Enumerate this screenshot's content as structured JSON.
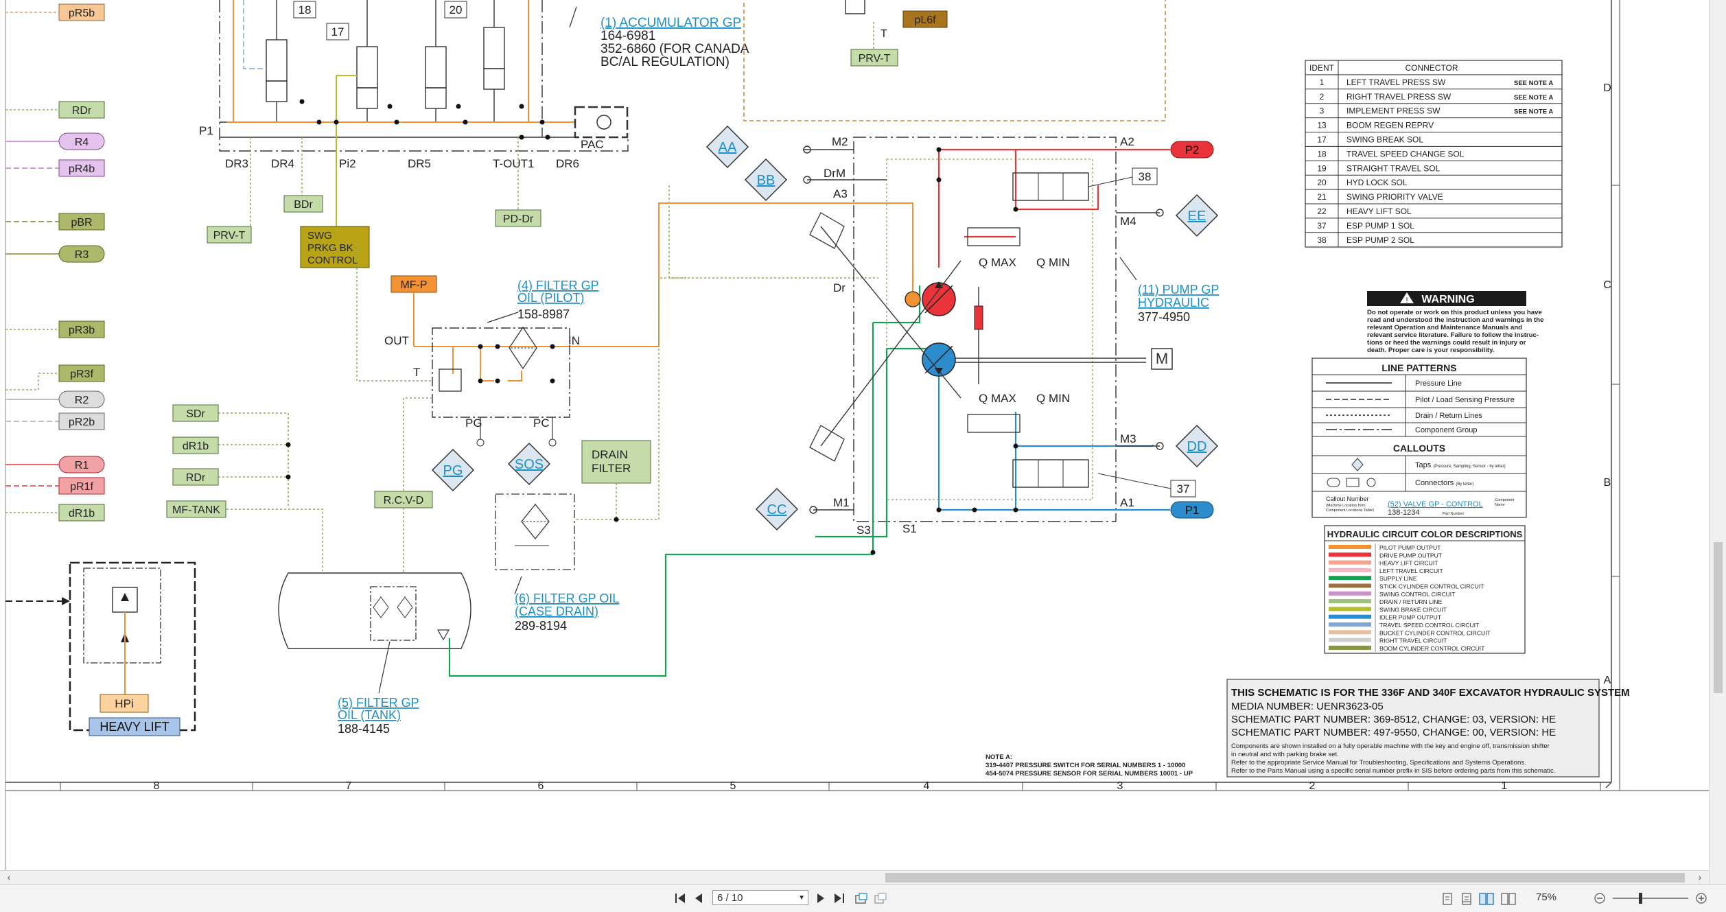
{
  "viewer": {
    "page_indicator": "6 / 10",
    "zoom": "75%",
    "colors": {
      "accent": "#1a8fc9",
      "toolbar_bg": "#f3f3f3"
    }
  },
  "top": {
    "left_tags": [
      "pR5b",
      "RDr",
      "R4",
      "pR4b",
      "pBR",
      "R3",
      "pR3b",
      "pR3f",
      "R2",
      "pR2b",
      "R1",
      "pR1f",
      "dR1b"
    ],
    "numbers": [
      "18",
      "17",
      "20"
    ],
    "p1": "P1",
    "pac": "PAC",
    "ports": [
      "DR3",
      "DR4",
      "Pi2",
      "DR5",
      "T-OUT1",
      "DR6"
    ],
    "accumulator": {
      "link": "(1) ACCUMULATOR GP",
      "pn1": "164-6981",
      "pn2": "352-6860 (FOR CANADA",
      "pn3": "BC/AL REGULATION)"
    },
    "pl6f": "pL6f",
    "t_label": "T",
    "prvt_top": "PRV-T",
    "bdr": "BDr",
    "prvt": "PRV-T",
    "pddr": "PD-Dr",
    "swg": [
      "SWG",
      "PRKG BK",
      "CONTROL"
    ],
    "mfp": "MF-P"
  },
  "filters": {
    "pilot": {
      "link1": "(4) FILTER GP",
      "link2": "OIL (PILOT)",
      "pn": "158-8987"
    },
    "out": "OUT",
    "in": "IN",
    "t": "T",
    "pg": "PG",
    "pc": "PC",
    "case": {
      "link1": "(6) FILTER GP OIL",
      "link2": "(CASE DRAIN)",
      "pn": "289-8194"
    },
    "tank": {
      "link1": "(5) FILTER GP",
      "link2": "OIL (TANK)",
      "pn": "188-4145"
    },
    "drain_filter": [
      "DRAIN",
      "FILTER"
    ],
    "taps": [
      "PG",
      "SOS"
    ],
    "rcvd": "R.C.V-D",
    "sdr": "SDr",
    "dr1b": "dR1b",
    "rdr": "RDr",
    "mftank": "MF-TANK"
  },
  "heavy": {
    "hpi": "HPi",
    "heavy_lift": "HEAVY LIFT"
  },
  "pump": {
    "taps": [
      "AA",
      "BB",
      "EE",
      "CC",
      "DD"
    ],
    "m2": "M2",
    "a2": "A2",
    "drm": "DrM",
    "a3": "A3",
    "m4": "M4",
    "dr": "Dr",
    "m3": "M3",
    "m1": "M1",
    "a1": "A1",
    "s3": "S3",
    "s1": "S1",
    "p2": "P2",
    "p1": "P1",
    "qmax": "Q MAX",
    "qmin": "Q MIN",
    "n38": "38",
    "n37": "37",
    "link1": "(11) PUMP GP",
    "link2": "HYDRAULIC",
    "pn": "377-4950"
  },
  "ident_table": {
    "headers": [
      "IDENT",
      "CONNECTOR"
    ],
    "rows": [
      [
        "1",
        "LEFT TRAVEL PRESS SW",
        "SEE NOTE A"
      ],
      [
        "2",
        "RIGHT TRAVEL PRESS SW",
        "SEE NOTE A"
      ],
      [
        "3",
        "IMPLEMENT PRESS SW",
        "SEE NOTE A"
      ],
      [
        "13",
        "BOOM REGEN REPRV",
        ""
      ],
      [
        "17",
        "SWING BREAK SOL",
        ""
      ],
      [
        "18",
        "TRAVEL SPEED CHANGE SOL",
        ""
      ],
      [
        "19",
        "STRAIGHT TRAVEL SOL",
        ""
      ],
      [
        "20",
        "HYD LOCK SOL",
        ""
      ],
      [
        "21",
        "SWING PRIORITY VALVE",
        ""
      ],
      [
        "22",
        "HEAVY LIFT SOL",
        ""
      ],
      [
        "37",
        "ESP PUMP 1 SOL",
        ""
      ],
      [
        "38",
        "ESP PUMP 2 SOL",
        ""
      ]
    ]
  },
  "warning": {
    "title": "WARNING",
    "lines": [
      "Do not operate or work on this product unless you have",
      "read and understood the instruction and warnings in the",
      "relevant Operation and Maintenance Manuals and",
      "relevant service literature. Failure to follow the instruc-",
      "tions or heed the warnings could result in injury or",
      "death. Proper care is your responsibility."
    ]
  },
  "legend": {
    "line_patterns_title": "LINE PATTERNS",
    "patterns": [
      "Pressure Line",
      "Pilot / Load Sensing Pressure",
      "Drain / Return Lines",
      "Component Group"
    ],
    "callouts_title": "CALLOUTS",
    "taps": "Taps",
    "taps_note": "(Pressure, Sampling, Sensor - by letter)",
    "connectors": "Connectors",
    "connectors_note": "(By letter)",
    "callout_number": "Callout Number",
    "callout_number_note1": "(Machine Location from",
    "callout_number_note2": "Component Locations Table)",
    "callout_link": "(52) VALVE GP - CONTROL",
    "callout_pn": "138-1234",
    "component_name": "Component",
    "component_name2": "Name",
    "part_number": "Part Number"
  },
  "color_table": {
    "title": "HYDRAULIC CIRCUIT COLOR DESCRIPTIONS",
    "rows": [
      {
        "color": "#f39233",
        "label": "PILOT PUMP OUTPUT"
      },
      {
        "color": "#e8343a",
        "label": "DRIVE PUMP OUTPUT"
      },
      {
        "color": "#f6a38a",
        "label": "HEAVY LIFT CIRCUIT"
      },
      {
        "color": "#f3b6c1",
        "label": "LEFT TRAVEL CIRCUIT"
      },
      {
        "color": "#12a250",
        "label": "SUPPLY LINE"
      },
      {
        "color": "#a07040",
        "label": "STICK CYLINDER CONTROL CIRCUIT"
      },
      {
        "color": "#c991c8",
        "label": "SWING CONTROL CIRCUIT"
      },
      {
        "color": "#9cc17a",
        "label": "DRAIN / RETURN LINE"
      },
      {
        "color": "#b5bd2a",
        "label": "SWING BRAKE CIRCUIT"
      },
      {
        "color": "#2c8ccc",
        "label": "IDLER PUMP OUTPUT"
      },
      {
        "color": "#7fa7d6",
        "label": "TRAVEL SPEED CONTROL CIRCUIT"
      },
      {
        "color": "#e6bfa0",
        "label": "BUCKET CYLINDER CONTROL CIRCUIT"
      },
      {
        "color": "#cfcfcf",
        "label": "RIGHT TRAVEL CIRCUIT"
      },
      {
        "color": "#88963a",
        "label": "BOOM CYLINDER CONTROL CIRCUIT"
      }
    ]
  },
  "title_block": {
    "line1": "THIS SCHEMATIC IS FOR THE 336F AND 340F EXCAVATOR HYDRAULIC SYSTEM",
    "line2": "MEDIA NUMBER: UENR3623-05",
    "line3": "SCHEMATIC PART NUMBER: 369-8512, CHANGE: 03, VERSION: HE",
    "line4": "SCHEMATIC PART NUMBER: 497-9550, CHANGE: 00, VERSION: HE",
    "notes": [
      "Components are shown installed on a fully operable machine with the key and engine off, transmission shifter",
      "in neutral and with parking brake set.",
      "Refer to the appropriate Service Manual for Troubleshooting, Specifications and Systems Operations.",
      "Refer to the Parts Manual using a specific serial number prefix in SIS before ordering parts from this schematic."
    ]
  },
  "note_a": {
    "title": "NOTE A:",
    "line1": "319-4407 PRESSURE SWITCH FOR SERIAL NUMBERS 1 - 10000",
    "line2": "454-5074 PRESSURE SENSOR FOR SERIAL NUMBERS 10001 - UP"
  },
  "zones": {
    "bottom": [
      "8",
      "7",
      "6",
      "5",
      "4",
      "3",
      "2",
      "1"
    ],
    "right": [
      "D",
      "C",
      "B",
      "A"
    ]
  }
}
